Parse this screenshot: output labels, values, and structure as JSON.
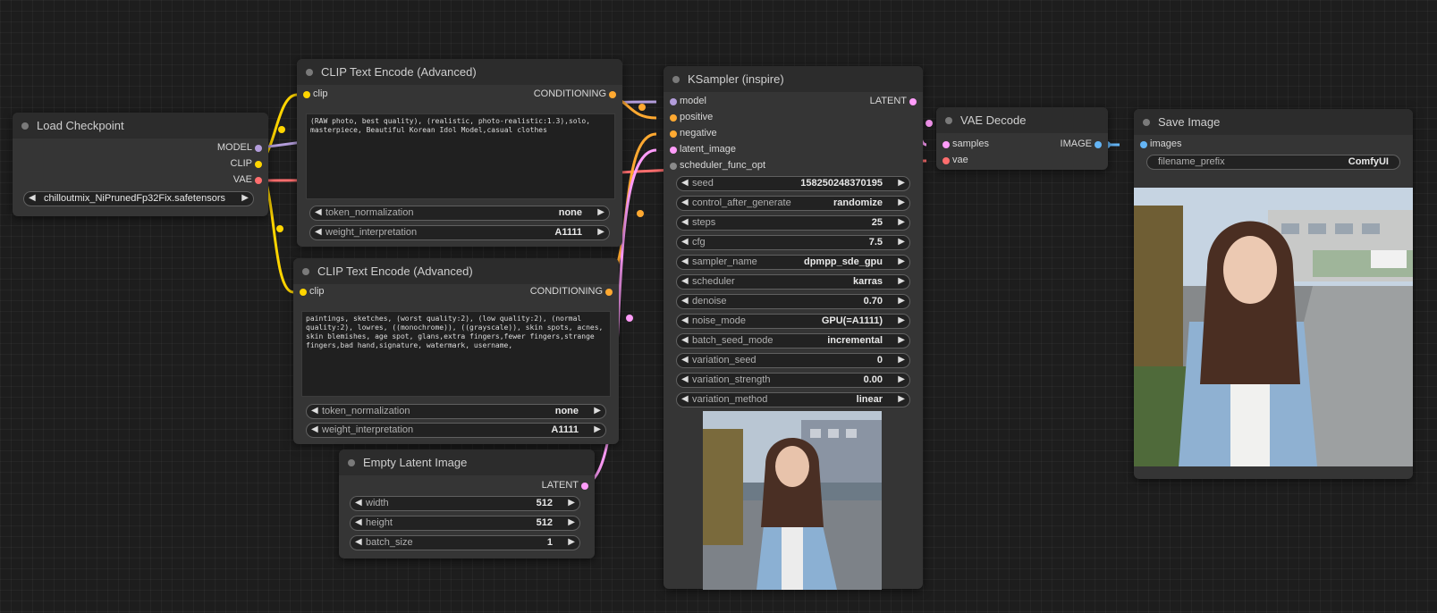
{
  "colors": {
    "clip": "#ffd500",
    "model": "#b39ddb",
    "vae": "#ff6e6e",
    "conditioning": "#ffa931",
    "latent": "#ff9cf9",
    "image": "#64b5f6"
  },
  "load_checkpoint": {
    "title": "Load Checkpoint",
    "outputs": {
      "model": "MODEL",
      "clip": "CLIP",
      "vae": "VAE"
    },
    "ckpt_name": "chilloutmix_NiPrunedFp32Fix.safetensors"
  },
  "clip_pos": {
    "title": "CLIP Text Encode (Advanced)",
    "input": "clip",
    "output": "CONDITIONING",
    "text": "(RAW photo, best quality), (realistic, photo-realistic:1.3),solo, masterpiece, Beautiful Korean Idol Model,casual clothes",
    "widgets": [
      {
        "label": "token_normalization",
        "value": "none"
      },
      {
        "label": "weight_interpretation",
        "value": "A1111"
      }
    ]
  },
  "clip_neg": {
    "title": "CLIP Text Encode (Advanced)",
    "input": "clip",
    "output": "CONDITIONING",
    "text": "paintings, sketches, (worst quality:2), (low quality:2), (normal quality:2), lowres, ((monochrome)), ((grayscale)), skin spots, acnes, skin blemishes, age spot, glans,extra fingers,fewer fingers,strange fingers,bad hand,signature, watermark, username,",
    "widgets": [
      {
        "label": "token_normalization",
        "value": "none"
      },
      {
        "label": "weight_interpretation",
        "value": "A1111"
      }
    ]
  },
  "empty_latent": {
    "title": "Empty Latent Image",
    "output": "LATENT",
    "widgets": [
      {
        "label": "width",
        "value": "512"
      },
      {
        "label": "height",
        "value": "512"
      },
      {
        "label": "batch_size",
        "value": "1"
      }
    ]
  },
  "ksampler": {
    "title": "KSampler (inspire)",
    "inputs": [
      "model",
      "positive",
      "negative",
      "latent_image",
      "scheduler_func_opt"
    ],
    "output": "LATENT",
    "widgets": [
      {
        "label": "seed",
        "value": "158250248370195"
      },
      {
        "label": "control_after_generate",
        "value": "randomize"
      },
      {
        "label": "steps",
        "value": "25"
      },
      {
        "label": "cfg",
        "value": "7.5"
      },
      {
        "label": "sampler_name",
        "value": "dpmpp_sde_gpu"
      },
      {
        "label": "scheduler",
        "value": "karras"
      },
      {
        "label": "denoise",
        "value": "0.70"
      },
      {
        "label": "noise_mode",
        "value": "GPU(=A1111)"
      },
      {
        "label": "batch_seed_mode",
        "value": "incremental"
      },
      {
        "label": "variation_seed",
        "value": "0"
      },
      {
        "label": "variation_strength",
        "value": "0.00"
      },
      {
        "label": "variation_method",
        "value": "linear"
      }
    ]
  },
  "vae_decode": {
    "title": "VAE Decode",
    "inputs": [
      "samples",
      "vae"
    ],
    "output": "IMAGE"
  },
  "save_image": {
    "title": "Save Image",
    "input": "images",
    "filename_prefix": {
      "label": "filename_prefix",
      "value": "ComfyUI"
    }
  }
}
